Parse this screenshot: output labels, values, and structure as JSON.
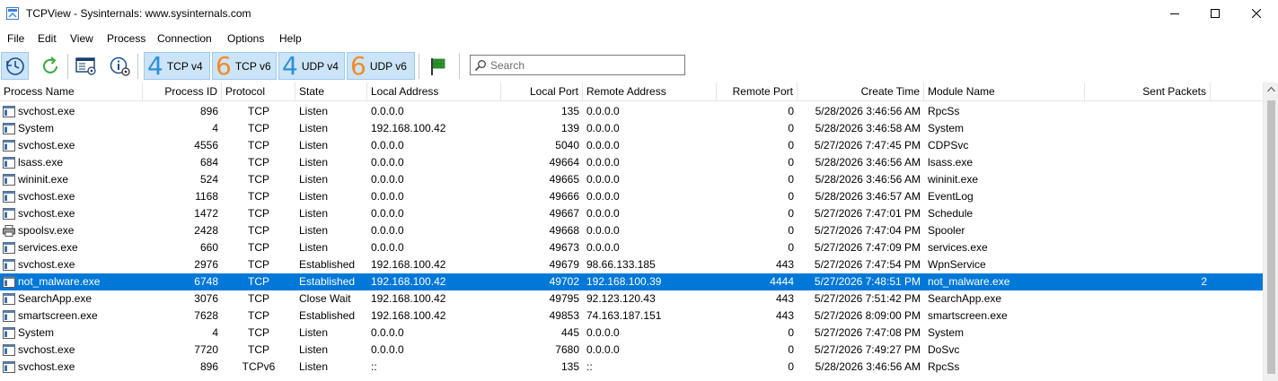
{
  "window": {
    "title": "TCPView - Sysinternals: www.sysinternals.com"
  },
  "menu": [
    "File",
    "Edit",
    "View",
    "Process",
    "Connection",
    "Options",
    "Help"
  ],
  "toolbar": {
    "icons": [
      "refresh-pause-icon",
      "refresh-icon",
      "save-icon",
      "whois-icon",
      "flag-icon"
    ],
    "protocols": [
      {
        "num": "4",
        "label": "TCP v4"
      },
      {
        "num": "6",
        "label": "TCP v6"
      },
      {
        "num": "4",
        "label": "UDP v4"
      },
      {
        "num": "6",
        "label": "UDP v6"
      }
    ],
    "search_placeholder": "Search"
  },
  "colors": {
    "selection": "#0078d7",
    "v4": "#2e8fd6",
    "v6": "#f08a2c"
  },
  "columns": [
    "Process Name",
    "Process ID",
    "Protocol",
    "State",
    "Local Address",
    "Local Port",
    "Remote Address",
    "Remote Port",
    "Create Time",
    "Module Name",
    "Sent Packets"
  ],
  "rows": [
    {
      "name": "svchost.exe",
      "pid": "896",
      "proto": "TCP",
      "state": "Listen",
      "laddr": "0.0.0.0",
      "lport": "135",
      "raddr": "0.0.0.0",
      "rport": "0",
      "time": "5/28/2026 3:46:56 AM",
      "module": "RpcSs",
      "sent": ""
    },
    {
      "name": "System",
      "pid": "4",
      "proto": "TCP",
      "state": "Listen",
      "laddr": "192.168.100.42",
      "lport": "139",
      "raddr": "0.0.0.0",
      "rport": "0",
      "time": "5/28/2026 3:46:58 AM",
      "module": "System",
      "sent": ""
    },
    {
      "name": "svchost.exe",
      "pid": "4556",
      "proto": "TCP",
      "state": "Listen",
      "laddr": "0.0.0.0",
      "lport": "5040",
      "raddr": "0.0.0.0",
      "rport": "0",
      "time": "5/27/2026 7:47:45 PM",
      "module": "CDPSvc",
      "sent": ""
    },
    {
      "name": "lsass.exe",
      "pid": "684",
      "proto": "TCP",
      "state": "Listen",
      "laddr": "0.0.0.0",
      "lport": "49664",
      "raddr": "0.0.0.0",
      "rport": "0",
      "time": "5/28/2026 3:46:56 AM",
      "module": "lsass.exe",
      "sent": ""
    },
    {
      "name": "wininit.exe",
      "pid": "524",
      "proto": "TCP",
      "state": "Listen",
      "laddr": "0.0.0.0",
      "lport": "49665",
      "raddr": "0.0.0.0",
      "rport": "0",
      "time": "5/28/2026 3:46:56 AM",
      "module": "wininit.exe",
      "sent": ""
    },
    {
      "name": "svchost.exe",
      "pid": "1168",
      "proto": "TCP",
      "state": "Listen",
      "laddr": "0.0.0.0",
      "lport": "49666",
      "raddr": "0.0.0.0",
      "rport": "0",
      "time": "5/28/2026 3:46:57 AM",
      "module": "EventLog",
      "sent": ""
    },
    {
      "name": "svchost.exe",
      "pid": "1472",
      "proto": "TCP",
      "state": "Listen",
      "laddr": "0.0.0.0",
      "lport": "49667",
      "raddr": "0.0.0.0",
      "rport": "0",
      "time": "5/27/2026 7:47:01 PM",
      "module": "Schedule",
      "sent": ""
    },
    {
      "name": "spoolsv.exe",
      "pid": "2428",
      "proto": "TCP",
      "state": "Listen",
      "laddr": "0.0.0.0",
      "lport": "49668",
      "raddr": "0.0.0.0",
      "rport": "0",
      "time": "5/27/2026 7:47:04 PM",
      "module": "Spooler",
      "sent": "",
      "icon": "printer-icon"
    },
    {
      "name": "services.exe",
      "pid": "660",
      "proto": "TCP",
      "state": "Listen",
      "laddr": "0.0.0.0",
      "lport": "49673",
      "raddr": "0.0.0.0",
      "rport": "0",
      "time": "5/27/2026 7:47:09 PM",
      "module": "services.exe",
      "sent": ""
    },
    {
      "name": "svchost.exe",
      "pid": "2976",
      "proto": "TCP",
      "state": "Established",
      "laddr": "192.168.100.42",
      "lport": "49679",
      "raddr": "98.66.133.185",
      "rport": "443",
      "time": "5/27/2026 7:47:54 PM",
      "module": "WpnService",
      "sent": ""
    },
    {
      "name": "not_malware.exe",
      "pid": "6748",
      "proto": "TCP",
      "state": "Established",
      "laddr": "192.168.100.42",
      "lport": "49702",
      "raddr": "192.168.100.39",
      "rport": "4444",
      "time": "5/27/2026 7:48:51 PM",
      "module": "not_malware.exe",
      "sent": "2",
      "selected": true
    },
    {
      "name": "SearchApp.exe",
      "pid": "3076",
      "proto": "TCP",
      "state": "Close Wait",
      "laddr": "192.168.100.42",
      "lport": "49795",
      "raddr": "92.123.120.43",
      "rport": "443",
      "time": "5/27/2026 7:51:42 PM",
      "module": "SearchApp.exe",
      "sent": ""
    },
    {
      "name": "smartscreen.exe",
      "pid": "7628",
      "proto": "TCP",
      "state": "Established",
      "laddr": "192.168.100.42",
      "lport": "49853",
      "raddr": "74.163.187.151",
      "rport": "443",
      "time": "5/27/2026 8:09:00 PM",
      "module": "smartscreen.exe",
      "sent": ""
    },
    {
      "name": "System",
      "pid": "4",
      "proto": "TCP",
      "state": "Listen",
      "laddr": "0.0.0.0",
      "lport": "445",
      "raddr": "0.0.0.0",
      "rport": "0",
      "time": "5/27/2026 7:47:08 PM",
      "module": "System",
      "sent": ""
    },
    {
      "name": "svchost.exe",
      "pid": "7720",
      "proto": "TCP",
      "state": "Listen",
      "laddr": "0.0.0.0",
      "lport": "7680",
      "raddr": "0.0.0.0",
      "rport": "0",
      "time": "5/27/2026 7:49:27 PM",
      "module": "DoSvc",
      "sent": ""
    },
    {
      "name": "svchost.exe",
      "pid": "896",
      "proto": "TCPv6",
      "state": "Listen",
      "laddr": "::",
      "lport": "135",
      "raddr": "::",
      "rport": "0",
      "time": "5/28/2026 3:46:56 AM",
      "module": "RpcSs",
      "sent": ""
    }
  ]
}
